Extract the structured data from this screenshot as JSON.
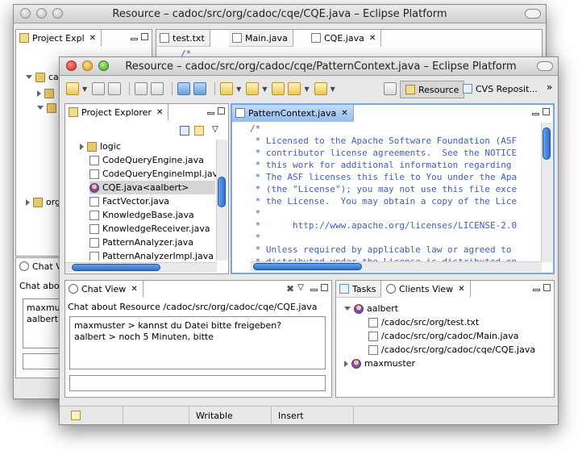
{
  "back_window": {
    "title": "Resource – cadoc/src/org/cadoc/cqe/CQE.java – Eclipse Platform",
    "explorer_tab": "Project Expl",
    "editor_tabs": [
      "test.txt",
      "Main.java",
      "CQE.java"
    ],
    "tree_labels": [
      "cad",
      "org"
    ],
    "editor_first_line": "/*",
    "chat_tab": "Chat V",
    "chat_about": "Chat abou",
    "chat_lines": [
      "maxmuste",
      "aalbert"
    ]
  },
  "front_window": {
    "title": "Resource – cadoc/src/org/cadoc/cqe/PatternContext.java – Eclipse Platform",
    "perspectives": [
      "Resource",
      "CVS Reposit..."
    ],
    "more_chevron": "»",
    "explorer": {
      "tab_label": "Project Explorer",
      "items": [
        {
          "label": "logic",
          "icon": "folder-icon"
        },
        {
          "label": "CodeQueryEngine.java",
          "icon": "java-file-icon"
        },
        {
          "label": "CodeQueryEngineImpl.jav",
          "icon": "java-file-icon"
        },
        {
          "label": "CQE.java<aalbert>",
          "icon": "java-file-icon"
        },
        {
          "label": "FactVector.java",
          "icon": "java-file-icon"
        },
        {
          "label": "KnowledgeBase.java",
          "icon": "java-file-icon"
        },
        {
          "label": "KnowledgeReceiver.java",
          "icon": "java-file-icon"
        },
        {
          "label": "PatternAnalyzer.java",
          "icon": "java-file-icon"
        },
        {
          "label": "PatternAnalyzerImpl.java",
          "icon": "java-file-icon"
        }
      ]
    },
    "editor": {
      "tab_label": "PatternContext.java",
      "lines": [
        "/*",
        " * Licensed to the Apache Software Foundation (ASF",
        " * contributor license agreements.  See the NOTICE",
        " * this work for additional information regarding",
        " * The ASF licenses this file to You under the Apa",
        " * (the \"License\"); you may not use this file exce",
        " * the License.  You may obtain a copy of the Lice",
        " *",
        " *      http://www.apache.org/licenses/LICENSE-2.0",
        " *",
        " * Unless required by applicable law or agreed to",
        " * distributed under the License is distributed on"
      ]
    },
    "chat": {
      "tab_label": "Chat View",
      "about": "Chat about Resource /cadoc/src/org/cadoc/cqe/CQE.java",
      "messages": [
        "maxmuster > kannst du Datei bitte freigeben?",
        "aalbert > noch 5 Minuten, bitte"
      ],
      "input_value": ""
    },
    "tasks_tab": "Tasks",
    "clients": {
      "tab_label": "Clients View",
      "users": [
        {
          "name": "aalbert",
          "files": [
            "/cadoc/src/org/test.txt",
            "/cadoc/src/org/cadoc/Main.java",
            "/cadoc/src/org/cadoc/cqe/CQE.java"
          ]
        },
        {
          "name": "maxmuster",
          "files": []
        }
      ]
    },
    "status": {
      "writable": "Writable",
      "insert": "Insert"
    }
  }
}
